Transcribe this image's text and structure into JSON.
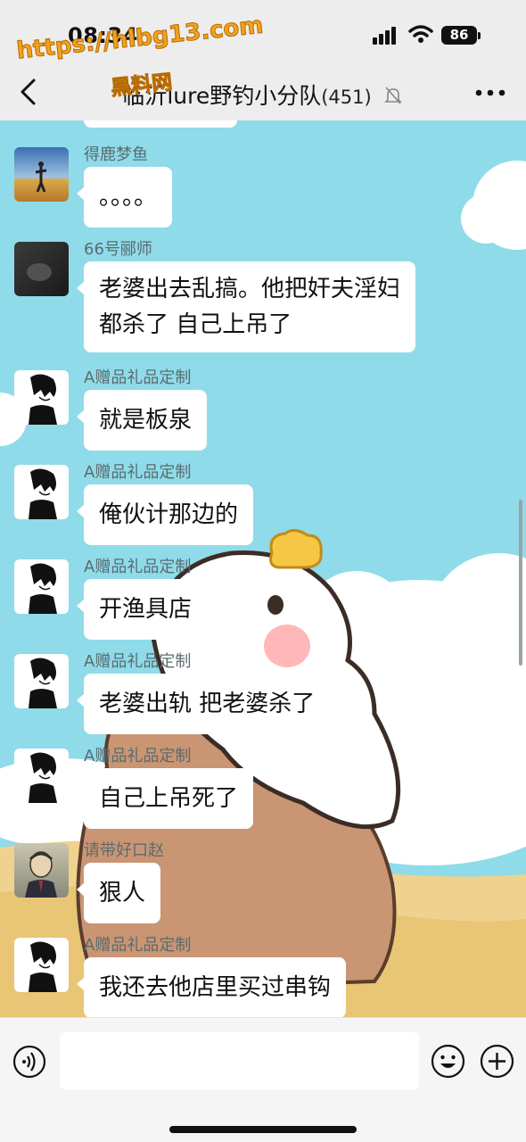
{
  "status": {
    "time": "08:34",
    "battery": "86"
  },
  "watermark": {
    "line1": "https://hlbg13.com",
    "line2": "黑料网"
  },
  "header": {
    "title": "临沂lure野钓小分队",
    "member_count": "(451)"
  },
  "messages": [
    {
      "sender": "得鹿梦鱼",
      "text": "。。。。"
    },
    {
      "sender": "66号郦师",
      "line1": "老婆出去乱搞。他把奸夫淫妇",
      "line2": "都杀了 自己上吊了"
    },
    {
      "sender": "A赠品礼品定制",
      "text": "就是板泉"
    },
    {
      "sender": "A赠品礼品定制",
      "text": "俺伙计那边的"
    },
    {
      "sender": "A赠品礼品定制",
      "text": "开渔具店"
    },
    {
      "sender": "A赠品礼品定制",
      "text": "老婆出轨 把老婆杀了"
    },
    {
      "sender": "A赠品礼品定制",
      "text": "自己上吊死了"
    },
    {
      "sender": "请带好口赵",
      "text": "狠人"
    },
    {
      "sender": "A赠品礼品定制",
      "text": "我还去他店里买过串钩"
    }
  ],
  "input": {
    "placeholder": ""
  },
  "colors": {
    "sky": "#8fdbe9",
    "bubble": "#ffffff",
    "header": "#ededed",
    "sender_name": "#5a6b70"
  }
}
